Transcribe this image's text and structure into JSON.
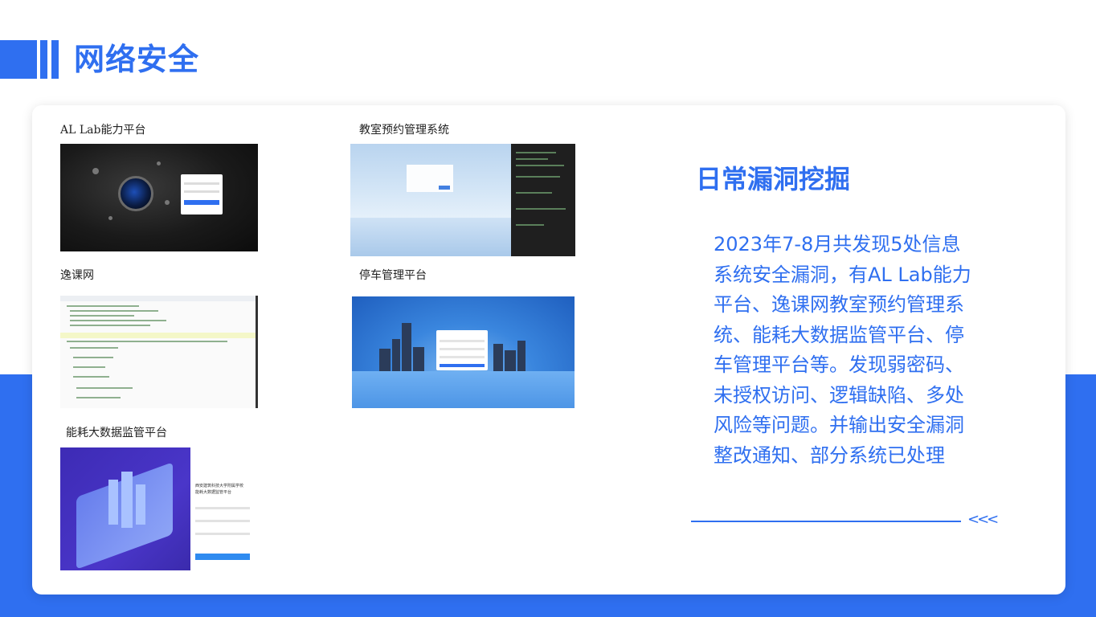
{
  "header": {
    "title": "网络安全"
  },
  "screenshots": [
    {
      "label": "AL Lab能力平台"
    },
    {
      "label": "教室预约管理系统"
    },
    {
      "label": "逸课网"
    },
    {
      "label": "停车管理平台"
    },
    {
      "label": "能耗大数据监管平台"
    }
  ],
  "energy_login_title": "西安建筑科技大学附属学校能耗大数据监管平台",
  "summary": {
    "title": "日常漏洞挖掘",
    "body": "2023年7-8月共发现5处信息系统安全漏洞，有AL Lab能力平台、逸课网教室预约管理系统、能耗大数据监管平台、停车管理平台等。发现弱密码、未授权访问、逻辑缺陷、多处风险等问题。并输出安全漏洞整改通知、部分系统已处理",
    "arrows": "<<<"
  },
  "colors": {
    "accent": "#2f6ff0",
    "band": "#2f6ff0"
  }
}
